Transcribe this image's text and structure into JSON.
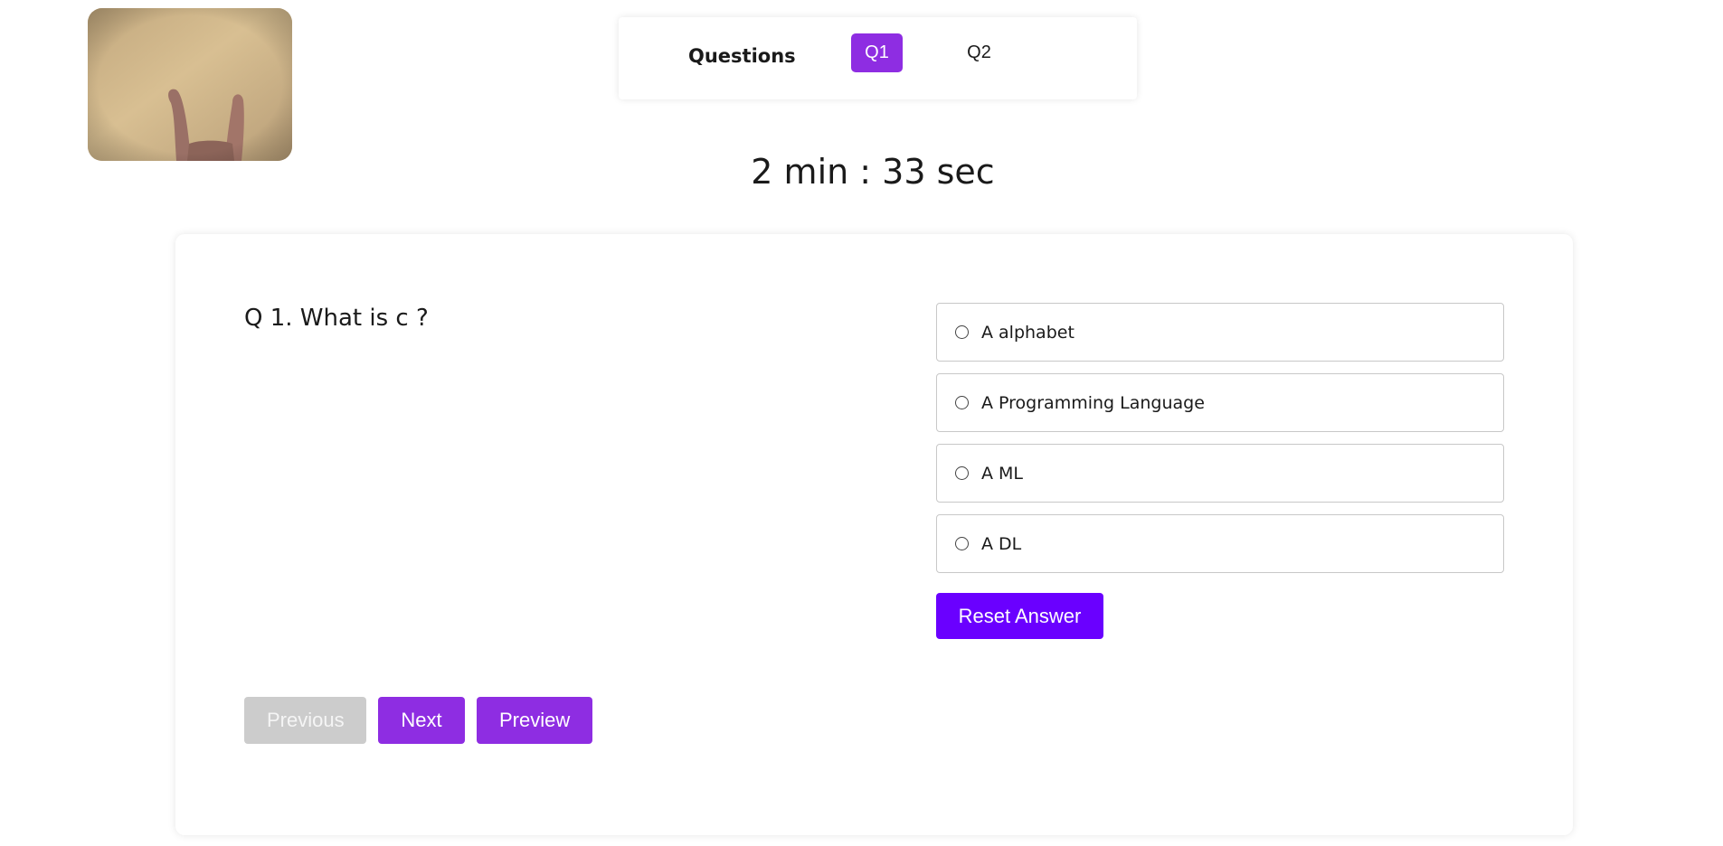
{
  "webcam": {
    "icon": "webcam-feed"
  },
  "questions_nav": {
    "title": "Questions",
    "items": [
      {
        "label": "Q1",
        "active": true
      },
      {
        "label": "Q2",
        "active": false
      }
    ],
    "accent_color": "#8e2de2"
  },
  "timer": {
    "text": "2 min : 33 sec"
  },
  "question": {
    "text": "Q 1. What is c ?",
    "options": [
      {
        "label": "A alphabet",
        "selected": false
      },
      {
        "label": "A Programming Language",
        "selected": false
      },
      {
        "label": "A ML",
        "selected": false
      },
      {
        "label": "A DL",
        "selected": false
      }
    ],
    "reset_label": "Reset Answer",
    "reset_color": "#6a00ff"
  },
  "navigation": {
    "previous_label": "Previous",
    "next_label": "Next",
    "preview_label": "Preview",
    "disabled_color": "#cccccc"
  }
}
